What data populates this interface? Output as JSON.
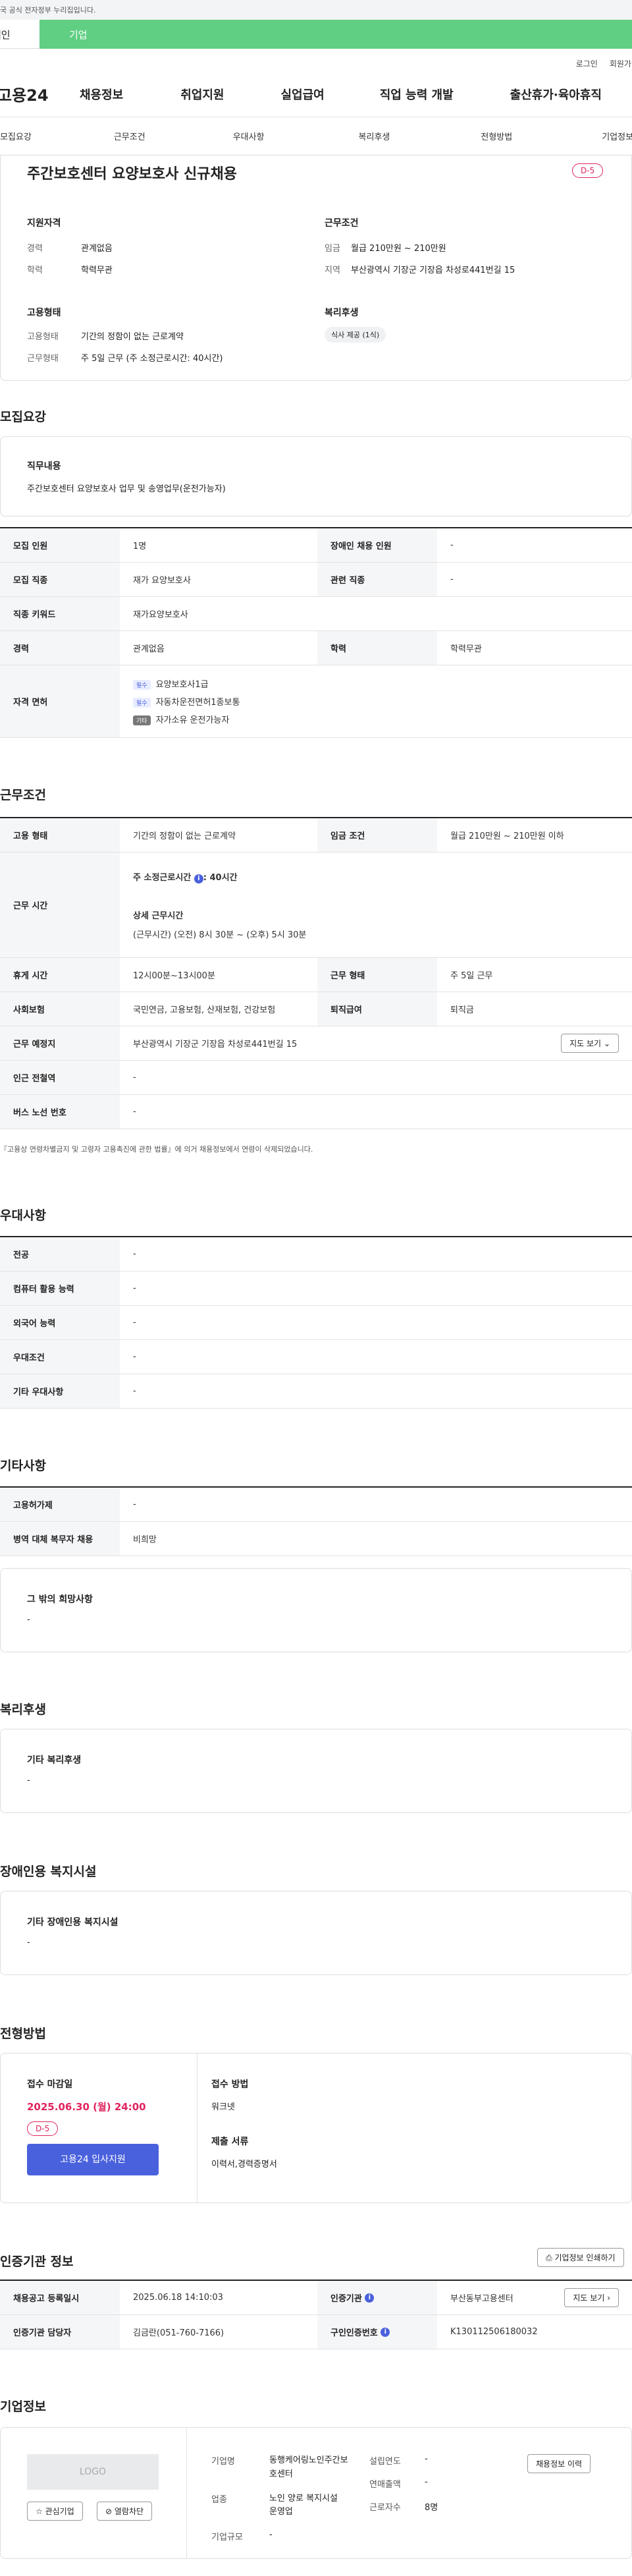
{
  "gov_banner": "이 누리집은 대한민국 공식 전자정부 누리집입니다.",
  "top_tabs": {
    "individual": "개인",
    "company": "기업"
  },
  "util": [
    "로그인",
    "회원가입"
  ],
  "logo": "고용24",
  "gnb": [
    "채용정보",
    "취업지원",
    "실업급여",
    "직업 능력 개발",
    "출산휴가·육아휴직"
  ],
  "snb": [
    "모집요강",
    "근무조건",
    "우대사항",
    "복리후생",
    "전형방법",
    "기업정보"
  ],
  "summary": {
    "title": "주간보호센터 요양보호사 신규채용",
    "dday": "D-5",
    "qual_h": "지원자격",
    "career_l": "경력",
    "career_v": "관계없음",
    "edu_l": "학력",
    "edu_v": "학력무관",
    "cond_h": "근무조건",
    "wage_l": "임금",
    "wage_v": "월급 210만원 ~ 210만원",
    "region_l": "지역",
    "region_v": "부산광역시 기장군 기장읍 차성로441번길 15",
    "emp_h": "고용형태",
    "emptype_l": "고용형태",
    "emptype_v": "기간의 정함이 없는 근로계약",
    "workform_l": "근무형태",
    "workform_v": "주 5일 근무 (주 소정근로시간: 40시간)",
    "welfare_h": "복리후생",
    "welfare_tag": "식사 제공 (1식)"
  },
  "recruit": {
    "title": "모집요강",
    "duty_h": "직무내용",
    "duty_v": "주간보호센터 요양보호사 업무 및 송영업무(운전가능자)",
    "r1": [
      "모집 인원",
      "1명",
      "장애인 채용 인원",
      "-"
    ],
    "r2": [
      "모집 직종",
      "재가 요양보호사",
      "관련 직종",
      "-"
    ],
    "r3": [
      "직종 키워드",
      "재가요양보호사"
    ],
    "r4": [
      "경력",
      "관계없음",
      "학력",
      "학력무관"
    ],
    "lic_h": "자격 면허",
    "lic": [
      {
        "tag": "필수",
        "v": "요양보호사1급"
      },
      {
        "tag": "필수",
        "v": "자동차운전면허1종보통"
      },
      {
        "tag": "기타",
        "v": "자가소유 운전가능자"
      }
    ]
  },
  "work": {
    "title": "근무조건",
    "r1": [
      "고용 형태",
      "기간의 정함이 없는 근로계약",
      "임금 조건",
      "월급 210만원 ~ 210만원 이하"
    ],
    "hours_h": "근무 시간",
    "hours_a": "주 소정근로시간",
    "hours_b": ": 40시간",
    "detail_h": "상세 근무시간",
    "detail_v": "(근무시간) (오전) 8시 30분 ~ (오후) 5시 30분",
    "r3": [
      "휴게 시간",
      "12시00분~13시00분",
      "근무 형태",
      "주 5일 근무"
    ],
    "r4": [
      "사회보험",
      "국민연금, 고용보험, 산재보험, 건강보험",
      "퇴직급여",
      "퇴직금"
    ],
    "r5": [
      "근무 예정지",
      "부산광역시 기장군 기장읍 차성로441번길 15"
    ],
    "map_btn": "지도 보기",
    "r6": [
      "인근 전철역",
      "-"
    ],
    "r7": [
      "버스 노선 번호",
      "-"
    ],
    "note": "『고용상 연령차별금지 및 고령자 고용촉진에 관한 법률』에 의거 채용정보에서 연령이 삭제되었습니다."
  },
  "pref": {
    "title": "우대사항",
    "rows": [
      [
        "전공",
        "-"
      ],
      [
        "컴퓨터 활용 능력",
        "-"
      ],
      [
        "외국어 능력",
        "-"
      ],
      [
        "우대조건",
        "-"
      ],
      [
        "기타 우대사항",
        "-"
      ]
    ]
  },
  "other": {
    "title": "기타사항",
    "rows": [
      [
        "고용허가제",
        "-"
      ],
      [
        "병역 대체 복무자 채용",
        "비희망"
      ]
    ],
    "wish_h": "그 밖의 희망사항",
    "wish_v": "-"
  },
  "welfare": {
    "title": "복리후생",
    "h": "기타 복리후생",
    "v": "-"
  },
  "disab": {
    "title": "장애인용 복지시설",
    "h": "기타 장애인용 복지시설",
    "v": "-"
  },
  "select": {
    "title": "전형방법",
    "deadline_h": "접수 마감일",
    "deadline_v": "2025.06.30 (월) 24:00",
    "dday": "D-5",
    "apply_btn": "고용24 입사지원",
    "method_h": "접수 방법",
    "method_v": "워크넷",
    "doc_h": "제출 서류",
    "doc_v": "이력서,경력증명서"
  },
  "cert": {
    "title": "인증기관 정보",
    "print_btn": "기업정보 인쇄하기",
    "r1": [
      "채용공고 등록일시",
      "2025.06.18 14:10:03",
      "인증기관",
      "부산동부고용센터"
    ],
    "r2": [
      "인증기관 담당자",
      "김금란(051-760-7166)",
      "구인인증번호",
      "K130112506180032"
    ],
    "map_btn": "지도 보기"
  },
  "company": {
    "title": "기업정보",
    "logo": "LOGO",
    "fav_btn": "관심기업",
    "block_btn": "열람차단",
    "name_l": "기업명",
    "name_v": "동행케어링노인주간보호센터",
    "ind_l": "업종",
    "ind_v": "노인 양로 복지시설 운영업",
    "scale_l": "기업규모",
    "scale_v": "-",
    "est_l": "설립연도",
    "est_v": "-",
    "sales_l": "연매출액",
    "sales_v": "-",
    "emp_l": "근로자수",
    "emp_v": "8명",
    "hist_btn": "채용정보 이력"
  },
  "colors": {
    "green": "#60cf84",
    "red": "#e0245e",
    "blue": "#4a61dd"
  }
}
